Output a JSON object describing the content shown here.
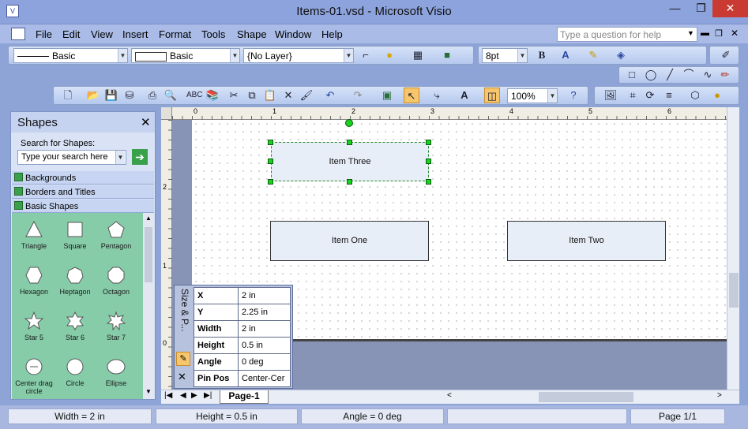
{
  "window": {
    "title": "Items-01.vsd - Microsoft Visio",
    "minimize_glyph": "—",
    "restore_glyph": "❐",
    "close_glyph": "✕"
  },
  "menu": {
    "items": [
      "File",
      "Edit",
      "View",
      "Insert",
      "Format",
      "Tools",
      "Shape",
      "Window",
      "Help"
    ],
    "ask_placeholder": "Type a question for help"
  },
  "format_toolbar": {
    "line_style": "Basic",
    "fill_style": "Basic",
    "layer": "{No Layer}",
    "font_size": "8pt"
  },
  "standard_toolbar": {
    "zoom": "100%"
  },
  "shapes_panel": {
    "title": "Shapes",
    "search_label": "Search for Shapes:",
    "search_placeholder": "Type your search here",
    "stencils": [
      "Backgrounds",
      "Borders and Titles",
      "Basic Shapes"
    ],
    "items": [
      {
        "label": "Triangle",
        "icon": "triangle-icon"
      },
      {
        "label": "Square",
        "icon": "square-icon"
      },
      {
        "label": "Pentagon",
        "icon": "pentagon-icon"
      },
      {
        "label": "Hexagon",
        "icon": "hexagon-icon"
      },
      {
        "label": "Heptagon",
        "icon": "heptagon-icon"
      },
      {
        "label": "Octagon",
        "icon": "octagon-icon"
      },
      {
        "label": "Star 5",
        "icon": "star5-icon"
      },
      {
        "label": "Star 6",
        "icon": "star6-icon"
      },
      {
        "label": "Star 7",
        "icon": "star7-icon"
      },
      {
        "label": "Center drag circle",
        "icon": "center-drag-circle-icon"
      },
      {
        "label": "Circle",
        "icon": "circle-icon"
      },
      {
        "label": "Ellipse",
        "icon": "ellipse-icon"
      }
    ]
  },
  "ruler": {
    "top_labels": [
      "0",
      "1",
      "2",
      "3",
      "4",
      "5",
      "6"
    ],
    "left_labels": [
      "2",
      "1",
      "0"
    ]
  },
  "drawing": {
    "shapes": [
      {
        "name": "item-three",
        "label": "Item Three",
        "selected": true
      },
      {
        "name": "item-one",
        "label": "Item One",
        "selected": false
      },
      {
        "name": "item-two",
        "label": "Item Two",
        "selected": false
      }
    ]
  },
  "size_position": {
    "title": "Size & P...",
    "rows": [
      {
        "label": "X",
        "value": "2 in"
      },
      {
        "label": "Y",
        "value": "2.25 in"
      },
      {
        "label": "Width",
        "value": "2 in"
      },
      {
        "label": "Height",
        "value": "0.5 in"
      },
      {
        "label": "Angle",
        "value": "0 deg"
      },
      {
        "label": "Pin Pos",
        "value": "Center-Cer"
      }
    ]
  },
  "page_tab": "Page-1",
  "status": {
    "width": "Width = 2 in",
    "height": "Height = 0.5 in",
    "angle": "Angle = 0 deg",
    "page": "Page 1/1"
  },
  "colors": {
    "title_bar": "#8da3dd",
    "selection_handle": "#19d11e",
    "stencil_bg": "#87cca9",
    "close_button": "#c83a32"
  }
}
